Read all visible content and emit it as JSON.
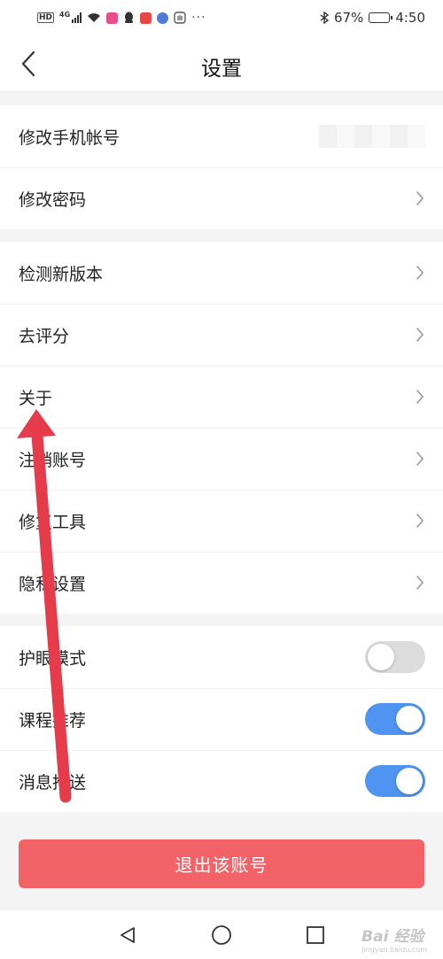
{
  "status_bar": {
    "hd": "HD",
    "network": "4G",
    "more": "···",
    "battery_percent": "67%",
    "battery_level": 0.67,
    "time": "4:50",
    "app_icon_colors": [
      "#e94c8c",
      "#e84545",
      "#4f7bd9"
    ]
  },
  "header": {
    "title": "设置",
    "back_icon": "chevron-left-icon"
  },
  "account_group": {
    "change_phone_label": "修改手机帐号",
    "change_password_label": "修改密码"
  },
  "general_group": {
    "check_update_label": "检测新版本",
    "rate_label": "去评分",
    "about_label": "关于",
    "cancel_account_label": "注销账号",
    "repair_tool_label": "修复工具",
    "privacy_label": "隐私设置"
  },
  "toggle_group": {
    "eye_care": {
      "label": "护眼模式",
      "enabled": false
    },
    "course_recommend": {
      "label": "课程推荐",
      "enabled": true
    },
    "push_message": {
      "label": "消息推送",
      "enabled": true
    }
  },
  "logout_button": "退出该账号",
  "system_nav": {
    "back_icon": "triangle-back-icon",
    "home_icon": "circle-home-icon",
    "recents_icon": "square-recents-icon"
  },
  "watermark": {
    "text": "Bai 经验",
    "sub": "jingyan.baidu.com"
  },
  "colors": {
    "accent": "#4e94f0",
    "logout": "#f36266",
    "annotation_arrow": "#e63b4a"
  }
}
